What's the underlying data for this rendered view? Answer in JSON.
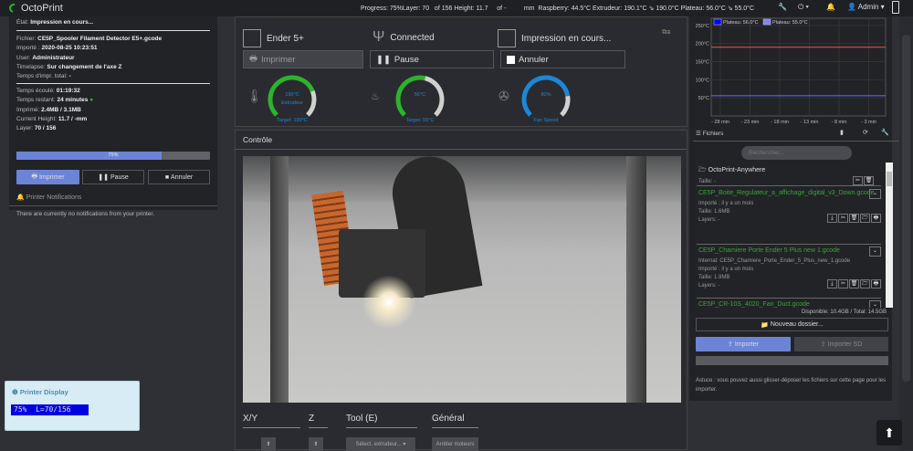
{
  "navbar": {
    "brand": "OctoPrint",
    "stats": "Progress: 75%Layer: 70   of 156 Height: 11.7     of -          mm  Raspberry: 44.5°C Extrudeur: 190.1°C ⇘ 190.0°C Plateau: 56.0°C ⇘ 55.0°C",
    "user": "Admin"
  },
  "state": {
    "etat_label": "État:",
    "etat": "Impression en cours...",
    "rows": [
      {
        "label": "Fichier:",
        "value": "CE5P_Spooler Filament Detector E5+.gcode"
      },
      {
        "label": "Importé :",
        "value": "2020-08-25 10:23:51"
      },
      {
        "label": "User:",
        "value": "Administrateur"
      },
      {
        "label": "Timelapse:",
        "value": "Sur changement de l'axe Z"
      },
      {
        "label": "Temps d'impr. total:",
        "value": "-"
      }
    ],
    "rows2": [
      {
        "label": "Temps écoulé:",
        "value": "01:19:32"
      },
      {
        "label": "Temps restant:",
        "value": "24 minutes"
      },
      {
        "label": "Imprimé:",
        "value": "2.4MB / 3.1MB"
      },
      {
        "label": "Current Height:",
        "value": "11.7 / -mm"
      },
      {
        "label": "Layer:",
        "value": "70 / 156"
      }
    ],
    "progress_percent": 75,
    "progress_label": "75%",
    "print": "Imprimer",
    "pause": "Pause",
    "cancel": "Annuler"
  },
  "notifications": {
    "title": "Printer Notifications",
    "message": "There are currently no notifications from your printer."
  },
  "printer_display": {
    "title": "Printer Display",
    "lcd": "75%  L=70/156"
  },
  "dashboard": {
    "printer": "Ender 5+",
    "connection": "Connected",
    "status": "Impression en cours...",
    "print": "Imprimer",
    "pause": "Pause",
    "cancel": "Annuler",
    "gauges": [
      {
        "value": "190°C",
        "name": "Extrudeur",
        "target": "Target: 190°C",
        "fraction": 0.75,
        "color": "#2cb32c"
      },
      {
        "value": "56°C",
        "name": "",
        "target": "Target: 55°C",
        "fraction": 0.55,
        "color": "#2cb32c"
      },
      {
        "value": "80%",
        "name": "",
        "target": "Fan Speed",
        "fraction": 0.8,
        "color": "#1e86d6"
      }
    ]
  },
  "chart": {
    "yticks": [
      "250°C",
      "200°C",
      "150°C",
      "100°C",
      "50°C"
    ],
    "xticks": [
      "- 28 min",
      "- 23 min",
      "- 18 min",
      "- 13 min",
      "- 8 min",
      "- 3 min"
    ],
    "legend": [
      "Plateau: 56.0°C",
      "Plateau: 55.0°C"
    ]
  },
  "control": {
    "title": "Contrôle",
    "tabs": [
      "X/Y",
      "Z",
      "Tool (E)",
      "Général"
    ],
    "select_extruder": "Sélect. extrudeur...",
    "stop_motors": "Arrêter moteurs"
  },
  "files": {
    "title": "Fichiers",
    "search_placeholder": "Rechercher...",
    "folder": {
      "name": "OctoPrint-Anywhere",
      "size": "Taille: -"
    },
    "items": [
      {
        "name": "CE5P_Boite_Regulateur_a_affichage_digital_v3_Down.gcode",
        "meta": [
          "Importé : il y a un mois",
          "Taille: 1.6MB",
          "Layers: -"
        ]
      },
      {
        "name": "CE5P_Chamiere Porte Ender 5 Plus new 1.gcode",
        "meta": [
          "Internal: CE5P_Chamiere_Porte_Ender_5_Plus_new_1.gcode",
          "Importé : il y a un mois",
          "Taille: 1.9MB",
          "Layers: -"
        ]
      },
      {
        "name": "CE5P_CR-10S_4020_Fan_Duct.gcode",
        "meta": []
      }
    ],
    "disk": "Disponible: 10.4GB / Total: 14.5GB",
    "new_folder": "Nouveau dossier...",
    "upload": "Importer",
    "upload_sd": "Importer SD",
    "hint": "Astuce : vous pouvez aussi glisser-déposer les fichiers sur cette page pour les importer."
  }
}
